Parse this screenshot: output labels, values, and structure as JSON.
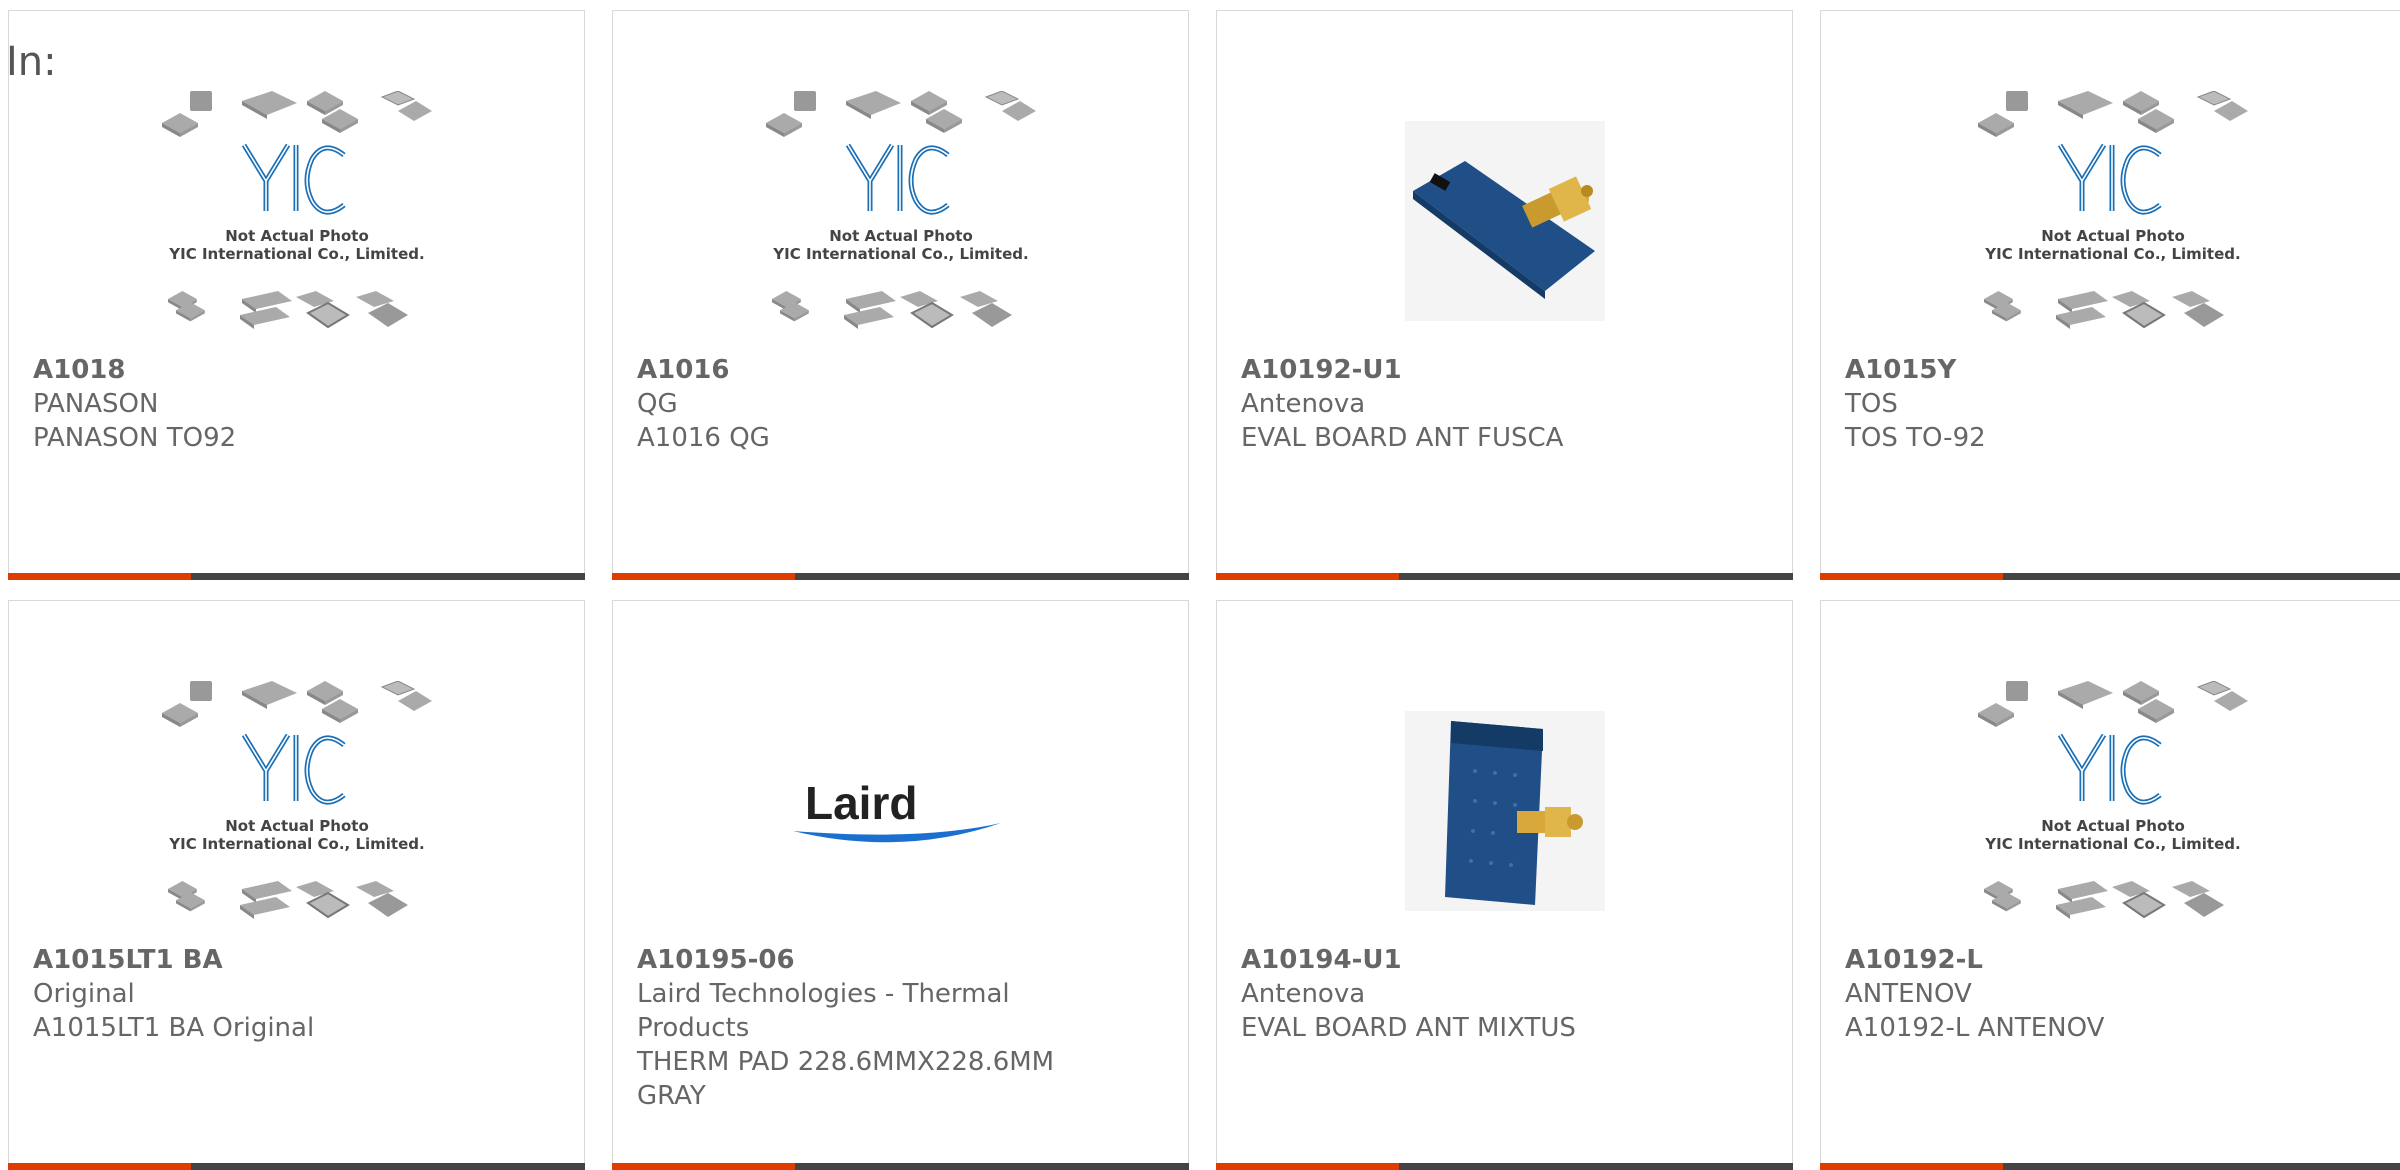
{
  "header": {
    "label": "In:"
  },
  "colors": {
    "accent": "#e13c00",
    "bar": "#444444",
    "border": "#d8d8d8",
    "text": "#666666"
  },
  "placeholder": {
    "line1": "Not Actual Photo",
    "line2": "YIC International Co., Limited."
  },
  "logo": {
    "laird": "Laird"
  },
  "products": [
    {
      "part": "A1018",
      "brand": "PANASON",
      "desc": [
        "PANASON TO92"
      ],
      "image": "yic-placeholder-icon"
    },
    {
      "part": "A1016",
      "brand": "QG",
      "desc": [
        "A1016 QG"
      ],
      "image": "yic-placeholder-icon"
    },
    {
      "part": "A10192-U1",
      "brand": "Antenova",
      "desc": [
        "EVAL BOARD ANT FUSCA"
      ],
      "image": "antenna-board-horizontal-icon"
    },
    {
      "part": "A1015Y",
      "brand": "TOS",
      "desc": [
        "TOS TO-92"
      ],
      "image": "yic-placeholder-icon"
    },
    {
      "part": "A1015LT1 BA",
      "brand": "Original",
      "desc": [
        "A1015LT1 BA Original"
      ],
      "image": "yic-placeholder-icon"
    },
    {
      "part": "A10195-06",
      "brand": "Laird Technologies - Thermal Products",
      "desc": [
        "THERM PAD 228.6MMX228.6MM GRAY"
      ],
      "image": "laird-logo-icon"
    },
    {
      "part": "A10194-U1",
      "brand": "Antenova",
      "desc": [
        "EVAL BOARD ANT MIXTUS"
      ],
      "image": "antenna-board-vertical-icon"
    },
    {
      "part": "A10192-L",
      "brand": "ANTENOV",
      "desc": [
        "A10192-L ANTENOV"
      ],
      "image": "yic-placeholder-icon"
    }
  ]
}
